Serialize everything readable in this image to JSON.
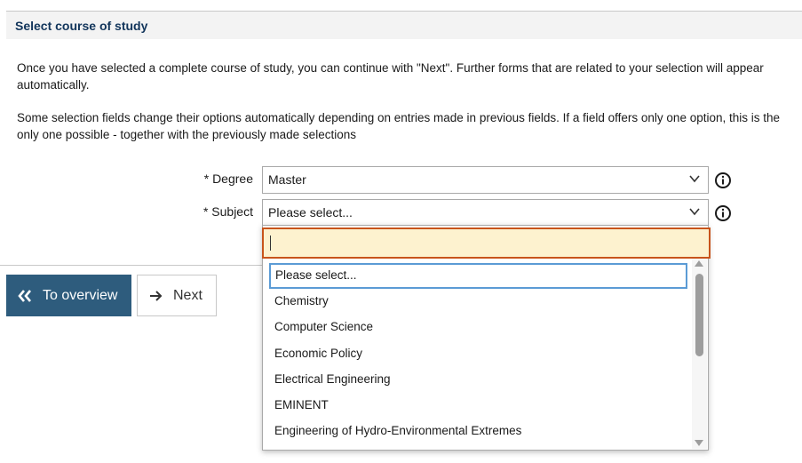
{
  "section": {
    "title": "Select course of study"
  },
  "intro": {
    "paragraph1": "Once you have selected a complete course of study, you can continue with \"Next\". Further forms that are related to your selection will appear automatically.",
    "paragraph2": "Some selection fields change their options automatically depending on entries made in previous fields. If a field offers only one option, this is the only one possible - together with the previously made selections"
  },
  "form": {
    "degree": {
      "label": "* Degree",
      "value": "Master"
    },
    "subject": {
      "label": "* Subject",
      "value": "Please select..."
    }
  },
  "dropdown": {
    "search_value": "",
    "options": [
      "Please select...",
      "Chemistry",
      "Computer Science",
      "Economic Policy",
      "Electrical Engineering",
      "EMINENT",
      "Engineering of Hydro-Environmental Extremes"
    ],
    "focused_index": 0
  },
  "buttons": {
    "overview_label": "To overview",
    "next_label": "Next"
  },
  "colors": {
    "header_text": "#12355b",
    "primary_button": "#2e5c7d",
    "search_highlight_bg": "#fdf2cf",
    "search_highlight_border": "#c8541b",
    "focus_border": "#5b9bd5"
  },
  "icons": {
    "overview": "double-chevron-left-icon",
    "next": "arrow-right-icon",
    "info": "info-circle-icon",
    "select": "chevron-down-icon"
  }
}
